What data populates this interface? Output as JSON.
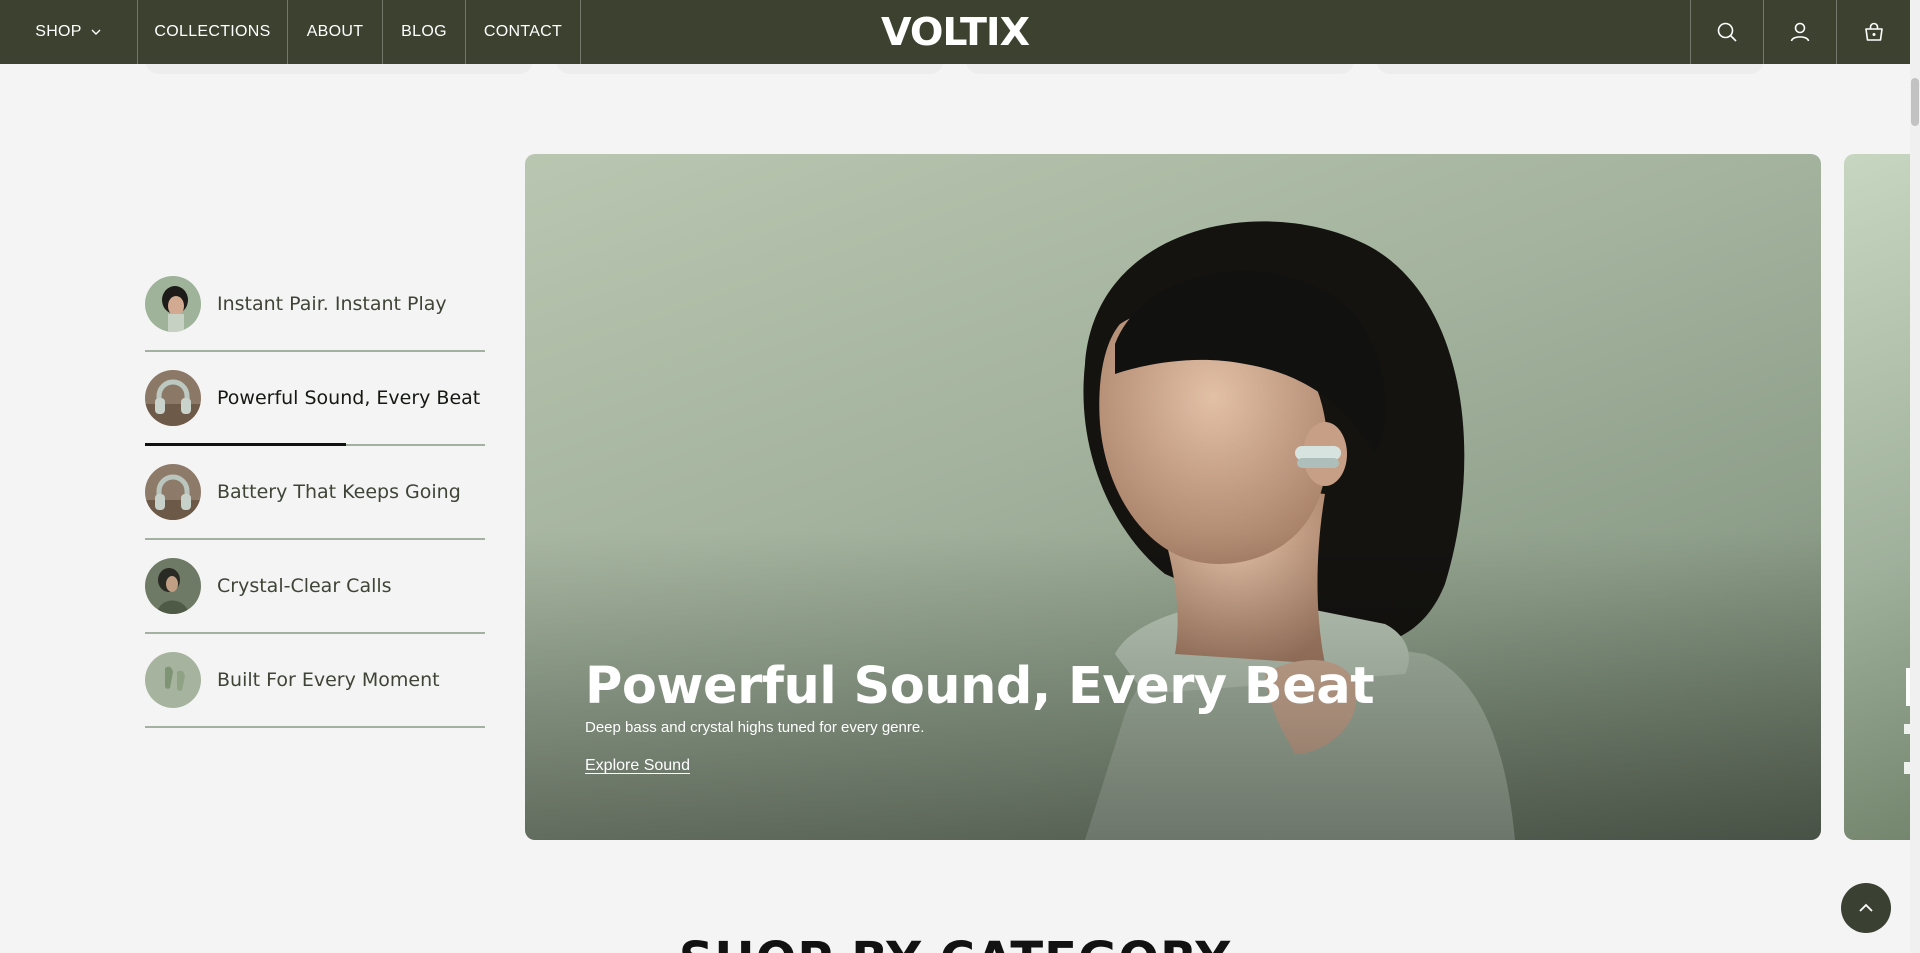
{
  "header": {
    "nav": [
      {
        "label": "SHOP"
      },
      {
        "label": "COLLECTIONS"
      },
      {
        "label": "ABOUT"
      },
      {
        "label": "BLOG"
      },
      {
        "label": "CONTACT"
      }
    ],
    "logo": "VOLTIX",
    "actions": [
      "search-icon",
      "account-icon",
      "cart-icon"
    ]
  },
  "features": {
    "items": [
      {
        "label": "Instant Pair. Instant Play",
        "thumb": "woman-portrait"
      },
      {
        "label": "Powerful Sound, Every Beat",
        "thumb": "headphones",
        "active": true,
        "progress": 0.59
      },
      {
        "label": "Battery That Keeps Going",
        "thumb": "headphones"
      },
      {
        "label": "Crystal-Clear Calls",
        "thumb": "person-listening"
      },
      {
        "label": "Built For Every Moment",
        "thumb": "earbuds"
      }
    ]
  },
  "hero": {
    "title": "Powerful Sound, Every Beat",
    "subtitle": "Deep bass and crystal highs tuned for every genre.",
    "link": "Explore Sound"
  },
  "section": {
    "heading": "SHOP BY CATEGORY"
  },
  "colors": {
    "header_bg": "#3d4230",
    "page_bg": "#f4f4f4",
    "hero_bg": "#a4b39e",
    "divider": "#a3b1a0",
    "back_to_top": "#3a4132"
  }
}
